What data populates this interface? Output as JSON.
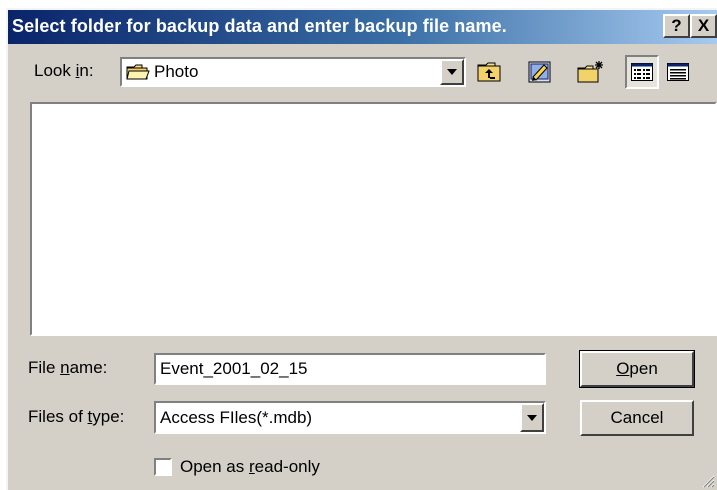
{
  "dialog": {
    "title": "Select folder for backup data and enter backup file name.",
    "help_label": "?",
    "close_label": "X"
  },
  "lookin": {
    "label_pre": "Look ",
    "label_accel": "i",
    "label_post": "n:",
    "value": "Photo"
  },
  "toolbar": {
    "icons": [
      "up-one-level-icon",
      "desktop-icon",
      "new-folder-icon",
      "list-view-icon",
      "details-view-icon"
    ]
  },
  "filename": {
    "label_pre": "File ",
    "label_accel": "n",
    "label_post": "ame:",
    "value": "Event_2001_02_15"
  },
  "filetype": {
    "label_pre": "Files of ",
    "label_accel": "t",
    "label_post": "ype:",
    "value": "Access FIles(*.mdb)"
  },
  "buttons": {
    "open_accel": "O",
    "open_rest": "pen",
    "cancel": "Cancel"
  },
  "readonly": {
    "label_pre": "Open as ",
    "label_accel": "r",
    "label_post": "ead-only",
    "checked": false
  }
}
